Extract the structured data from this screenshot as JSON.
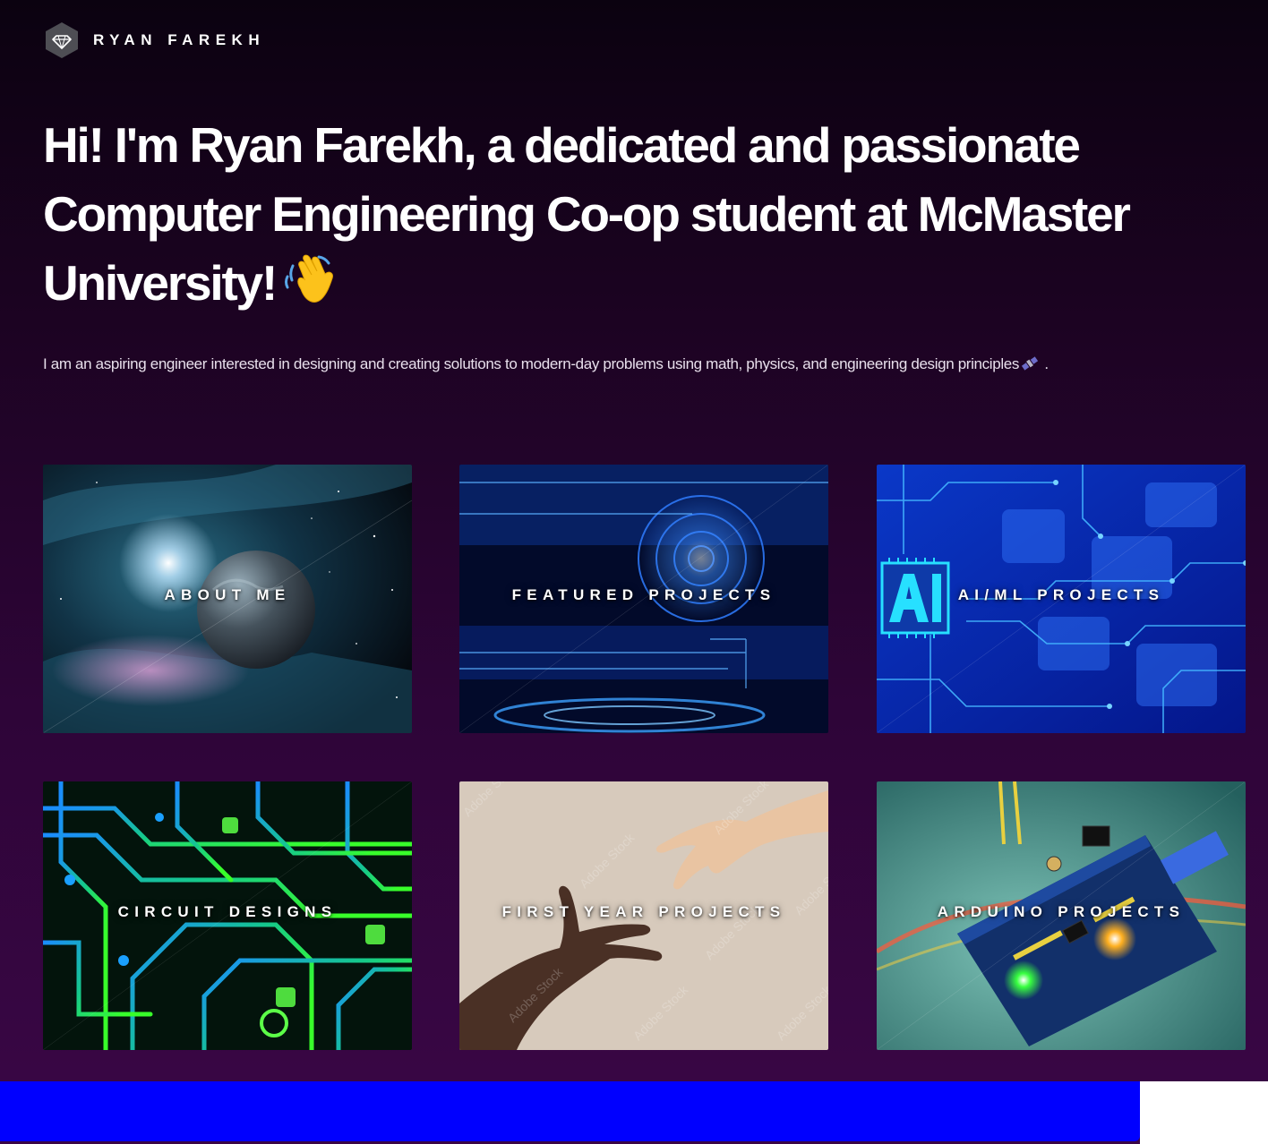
{
  "header": {
    "brand": "RYAN FAREKH",
    "logo_icon": "diamond-hexagon-icon"
  },
  "hero": {
    "title": "Hi! I'm Ryan Farekh, a dedicated and passionate Computer Engineering Co-op student at McMaster University!",
    "title_emoji": "waving-hand-icon",
    "intro_before": "I am an aspiring engineer interested in designing and creating solutions to modern-day problems using math, physics, and engineering design principles",
    "intro_emoji": "satellite-icon",
    "intro_after": " ."
  },
  "cards": [
    {
      "label": "ABOUT ME",
      "image": "planet-nebula-image"
    },
    {
      "label": "FEATURED PROJECTS",
      "image": "blue-tech-hud-image"
    },
    {
      "label": "AI/ML PROJECTS",
      "image": "ai-circuit-image"
    },
    {
      "label": "CIRCUIT DESIGNS",
      "image": "green-pcb-image"
    },
    {
      "label": "FIRST YEAR PROJECTS",
      "image": "reaching-hands-image"
    },
    {
      "label": "ARDUINO PROJECTS",
      "image": "arduino-board-image"
    }
  ],
  "colors": {
    "background_top": "#0b0210",
    "background_bottom": "#3a0646",
    "footer_bar": "#0000ff",
    "text": "#ffffff"
  }
}
